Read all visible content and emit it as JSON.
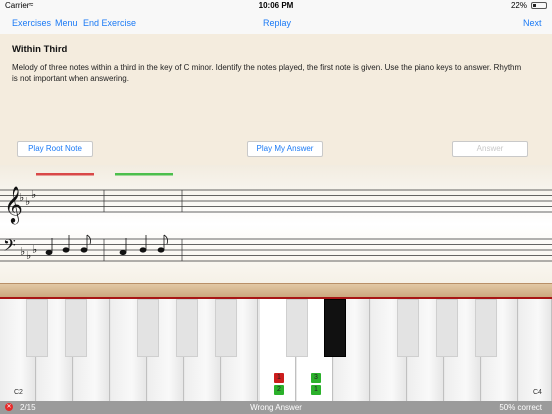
{
  "status_bar": {
    "carrier": "Carrier",
    "time": "10:06 PM",
    "battery": "22%"
  },
  "nav": {
    "exercises": "Exercises",
    "menu": "Menu",
    "end_exercise": "End Exercise",
    "replay": "Replay",
    "next": "Next"
  },
  "exercise": {
    "title": "Within Third",
    "description": "Melody of three notes within a third in the key of C minor. Identify the notes played, the first note is given. Use the piano keys to answer. Rhythm is not important when answering."
  },
  "buttons": {
    "play_root": "Play Root Note",
    "play_mine": "Play My Answer",
    "answer": "Answer"
  },
  "keyboard": {
    "start_label": "C2",
    "end_label": "C4",
    "markers": [
      {
        "num": "1",
        "color": "red"
      },
      {
        "num": "2",
        "color": "green"
      },
      {
        "num": "3",
        "color": "green"
      },
      {
        "num": "1",
        "color": "green"
      }
    ]
  },
  "bottom": {
    "close_icon": "x-icon",
    "progress": "2/15",
    "status": "Wrong Answer",
    "percent": "50% correct"
  },
  "colors": {
    "accent": "#1b7af5",
    "wrong": "#cc1d1d",
    "right": "#2bb12b",
    "panel": "#f4ecde"
  }
}
